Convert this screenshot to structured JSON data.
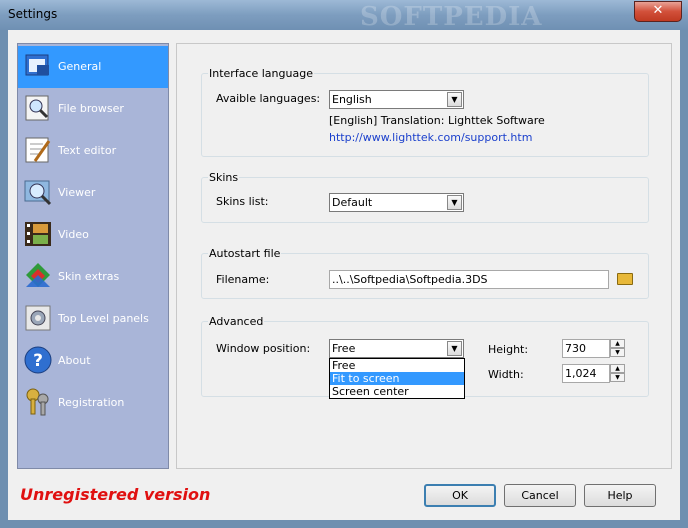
{
  "window": {
    "title": "Settings",
    "watermark": "SOFTPEDIA",
    "close_glyph": "✕"
  },
  "sidebar": {
    "items": [
      {
        "label": "General",
        "icon": "general-icon",
        "selected": true
      },
      {
        "label": "File browser",
        "icon": "file-browser-icon"
      },
      {
        "label": "Text editor",
        "icon": "text-editor-icon"
      },
      {
        "label": "Viewer",
        "icon": "viewer-icon"
      },
      {
        "label": "Video",
        "icon": "video-icon"
      },
      {
        "label": "Skin extras",
        "icon": "skin-extras-icon"
      },
      {
        "label": "Top Level panels",
        "icon": "top-level-panels-icon"
      },
      {
        "label": "About",
        "icon": "about-icon"
      },
      {
        "label": "Registration",
        "icon": "registration-icon"
      }
    ]
  },
  "interface_language": {
    "title": "Interface language",
    "languages_label": "Avaible languages:",
    "language_value": "English",
    "translation_text": "[English] Translation: Lighttek Software",
    "link": "http://www.lighttek.com/support.htm"
  },
  "skins": {
    "title": "Skins",
    "list_label": "Skins list:",
    "list_value": "Default"
  },
  "autostart": {
    "title": "Autostart file",
    "filename_label": "Filename:",
    "filename_value": "..\\..\\Softpedia\\Softpedia.3DS"
  },
  "advanced": {
    "title": "Advanced",
    "window_position_label": "Window position:",
    "window_position_value": "Free",
    "options": [
      "Free",
      "Fit to screen",
      "Screen center"
    ],
    "highlighted_option": "Fit to screen",
    "height_label": "Height:",
    "height_value": "730",
    "width_label": "Width:",
    "width_value": "1,024"
  },
  "footer": {
    "status": "Unregistered version",
    "ok": "OK",
    "cancel": "Cancel",
    "help": "Help"
  },
  "colors": {
    "selection": "#3399ff",
    "sidebar": "#a9b5d8",
    "status": "#e01010",
    "link": "#1a3fcc"
  }
}
